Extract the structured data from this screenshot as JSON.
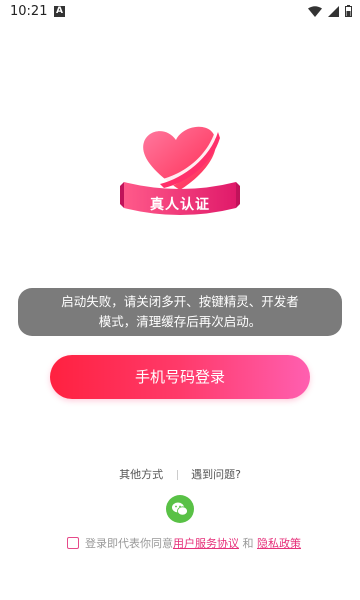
{
  "status_bar": {
    "time": "10:21",
    "notification_icon": "A"
  },
  "logo": {
    "text": "真人认证",
    "accent_color": "#ff2f6a"
  },
  "toast": {
    "line1": "启动失败，请关闭多开、按键精灵、开发者",
    "line2": "模式，清理缓存后再次启动。"
  },
  "login": {
    "phone_button_label": "手机号码登录"
  },
  "other": {
    "other_methods": "其他方式",
    "problem": "遇到问题?"
  },
  "agreement": {
    "prefix": "登录即代表你同意",
    "user_agreement": "用户服务协议",
    "and": " 和 ",
    "privacy_policy": "隐私政策"
  },
  "colors": {
    "primary_start": "#ff2140",
    "primary_end": "#ff5fb0",
    "wechat": "#59c146"
  }
}
